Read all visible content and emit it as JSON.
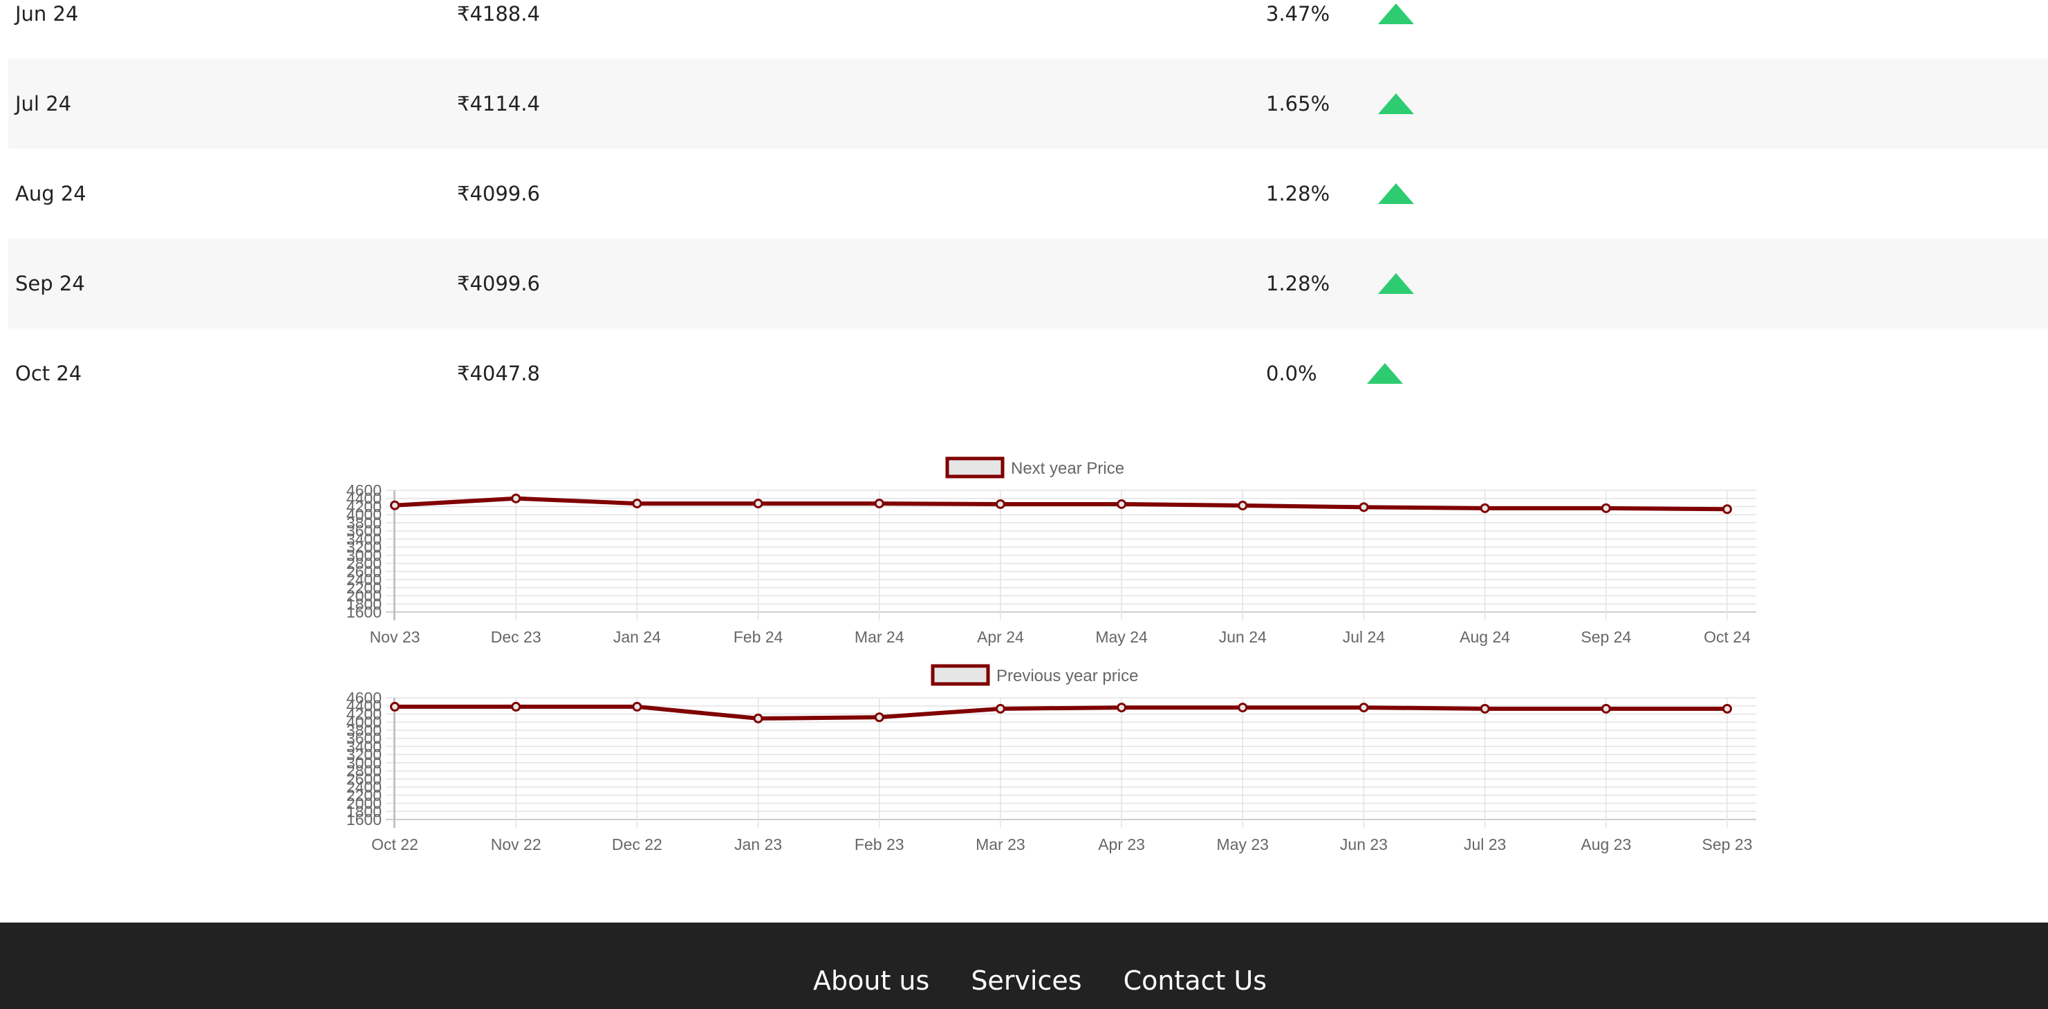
{
  "price_table": {
    "rows": [
      {
        "month": "Jun 24",
        "price": "₹4188.4",
        "change": "3.47%",
        "trend": "up-arrow-icon"
      },
      {
        "month": "Jul 24",
        "price": "₹4114.4",
        "change": "1.65%",
        "trend": "up-arrow-icon"
      },
      {
        "month": "Aug 24",
        "price": "₹4099.6",
        "change": "1.28%",
        "trend": "up-arrow-icon"
      },
      {
        "month": "Sep 24",
        "price": "₹4099.6",
        "change": "1.28%",
        "trend": "up-arrow-icon"
      },
      {
        "month": "Oct 24",
        "price": "₹4047.8",
        "change": "0.0%",
        "trend": "up-arrow-icon"
      }
    ],
    "colors": {
      "up": "#2ecc71",
      "row_alt": "#f7f7f7"
    }
  },
  "chart_data": [
    {
      "type": "line",
      "title": "",
      "legend": "Next year Price",
      "legend_position": "top",
      "color": "#800000",
      "x": [
        "Nov 23",
        "Dec 23",
        "Jan 24",
        "Feb 24",
        "Mar 24",
        "Apr 24",
        "May 24",
        "Jun 24",
        "Jul 24",
        "Aug 24",
        "Sep 24",
        "Oct 24"
      ],
      "y": [
        4230,
        4400,
        4275,
        4275,
        4275,
        4260,
        4260,
        4225,
        4185,
        4160,
        4160,
        4135
      ],
      "ylim": [
        1600,
        4600
      ],
      "yticks": [
        1600,
        1800,
        2000,
        2200,
        2400,
        2600,
        2800,
        3000,
        3200,
        3400,
        3600,
        3800,
        4000,
        4200,
        4400,
        4600
      ],
      "grid": true
    },
    {
      "type": "line",
      "title": "",
      "legend": "Previous year price",
      "legend_position": "top",
      "color": "#800000",
      "x": [
        "Oct 22",
        "Nov 22",
        "Dec 22",
        "Jan 23",
        "Feb 23",
        "Mar 23",
        "Apr 23",
        "May 23",
        "Jun 23",
        "Jul 23",
        "Aug 23",
        "Sep 23"
      ],
      "y": [
        4380,
        4380,
        4380,
        4090,
        4120,
        4330,
        4360,
        4360,
        4360,
        4330,
        4330,
        4330
      ],
      "ylim": [
        1600,
        4600
      ],
      "yticks": [
        1600,
        1800,
        2000,
        2200,
        2400,
        2600,
        2800,
        3000,
        3200,
        3400,
        3600,
        3800,
        4000,
        4200,
        4400,
        4600
      ],
      "grid": true
    }
  ],
  "footer": {
    "links": [
      "About us",
      "Services",
      "Contact Us"
    ],
    "background": "#222222"
  }
}
